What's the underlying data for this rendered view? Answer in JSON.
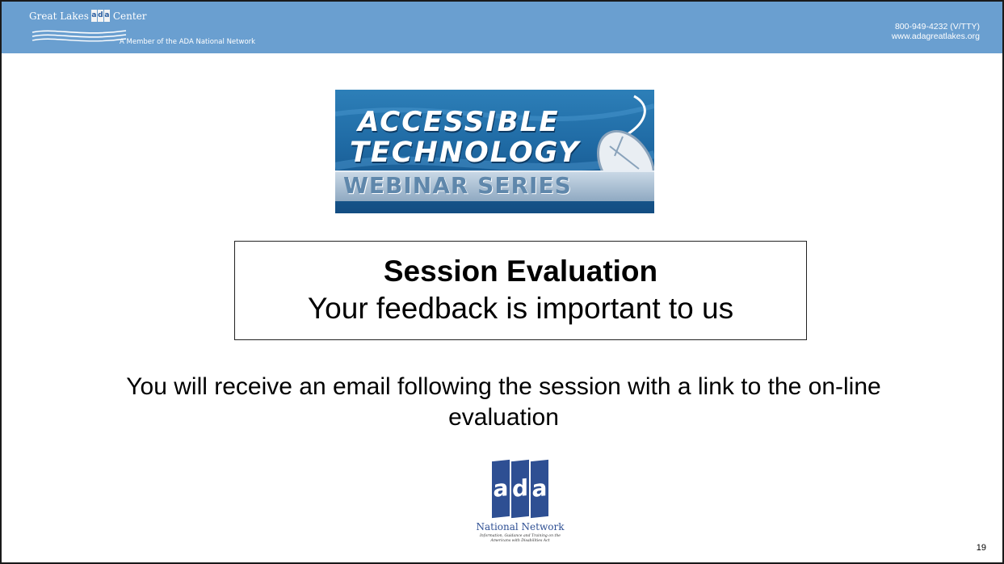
{
  "header": {
    "brand_prefix": "Great Lakes",
    "brand_badge": [
      "a",
      "d",
      "a"
    ],
    "brand_suffix": "Center",
    "member_text": "A Member of the ADA National Network",
    "phone": "800-949-4232 (V/TTY)",
    "website": "www.adagreatlakes.org",
    "color": "#6a9fd0"
  },
  "webinar_logo": {
    "line1": "ACCESSIBLE",
    "line2": "TECHNOLOGY",
    "line3": "WEBINAR SERIES",
    "icon": "computer-mouse-icon"
  },
  "evaluation": {
    "title": "Session Evaluation",
    "subtitle": "Your feedback is important to us"
  },
  "email_notice": "You will receive an email following the session with a link to the on-line evaluation",
  "ada_logo": {
    "letters": [
      "a",
      "d",
      "a"
    ],
    "network": "National Network",
    "tagline": "Information, Guidance and Training on the Americans with Disabilities Act",
    "color": "#2e4f93"
  },
  "page_number": "19"
}
